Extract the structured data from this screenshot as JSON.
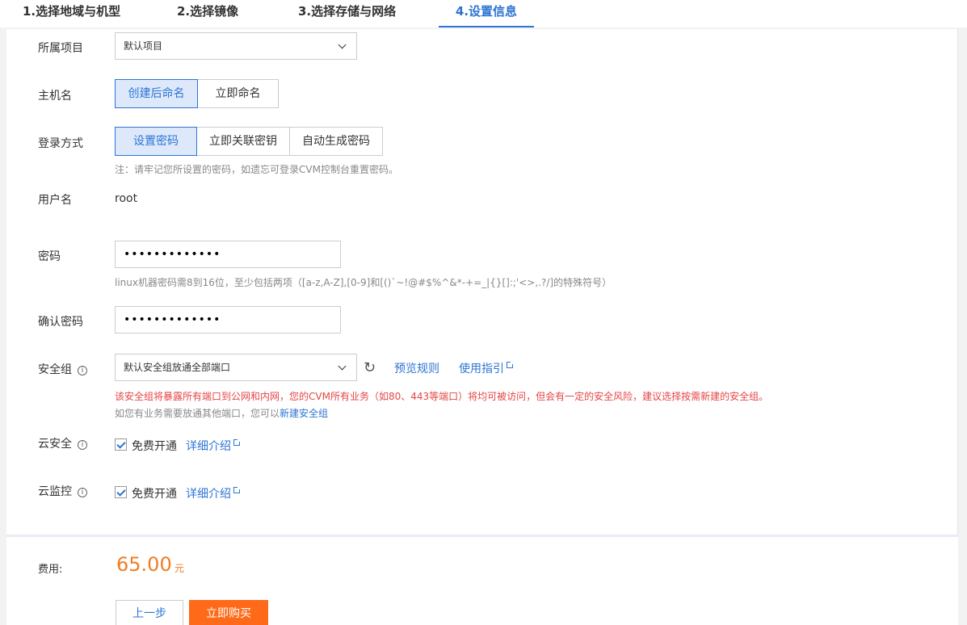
{
  "steps": [
    {
      "label": "1.选择地域与机型"
    },
    {
      "label": "2.选择镜像"
    },
    {
      "label": "3.选择存储与网络"
    },
    {
      "label": "4.设置信息",
      "active": true
    }
  ],
  "project": {
    "label": "所属项目",
    "value": "默认项目"
  },
  "hostname": {
    "label": "主机名",
    "options": [
      "创建后命名",
      "立即命名"
    ],
    "selected": "创建后命名"
  },
  "login": {
    "label": "登录方式",
    "options": [
      "设置密码",
      "立即关联密钥",
      "自动生成密码"
    ],
    "selected": "设置密码",
    "hint": "注：请牢记您所设置的密码，如遗忘可登录CVM控制台重置密码。"
  },
  "username": {
    "label": "用户名",
    "value": "root"
  },
  "password": {
    "label": "密码",
    "value": "•••••••••••••",
    "hint": "linux机器密码需8到16位，至少包括两项（[a-z,A-Z],[0-9]和[()`~!@#$%^&*-+=_|{}[]:;'<>,.?/]的特殊符号）"
  },
  "confirm_password": {
    "label": "确认密码",
    "value": "•••••••••••••"
  },
  "security_group": {
    "label": "安全组",
    "value": "默认安全组放通全部端口",
    "preview_link": "预览规则",
    "guide_link": "使用指引",
    "warning": "该安全组将暴露所有端口到公网和内网，您的CVM所有业务（如80、443等端口）将均可被访问，但会有一定的安全风险，建议选择按需新建的安全组。",
    "note_prefix": "如您有业务需要放通其他端口，您可以",
    "note_link": "新建安全组"
  },
  "cloud_security": {
    "label": "云安全",
    "checkbox_label": "免费开通",
    "checked": true,
    "detail_link": "详细介绍"
  },
  "cloud_monitor": {
    "label": "云监控",
    "checkbox_label": "免费开通",
    "checked": true,
    "detail_link": "详细介绍"
  },
  "footer": {
    "fee_label": "费用:",
    "price": "65.00",
    "unit": "元",
    "prev_button": "上一步",
    "buy_button": "立即购买"
  },
  "colors": {
    "accent": "#2d74d4",
    "price": "#f27c23",
    "buy": "#ff6a1a",
    "warning": "#e54545"
  }
}
